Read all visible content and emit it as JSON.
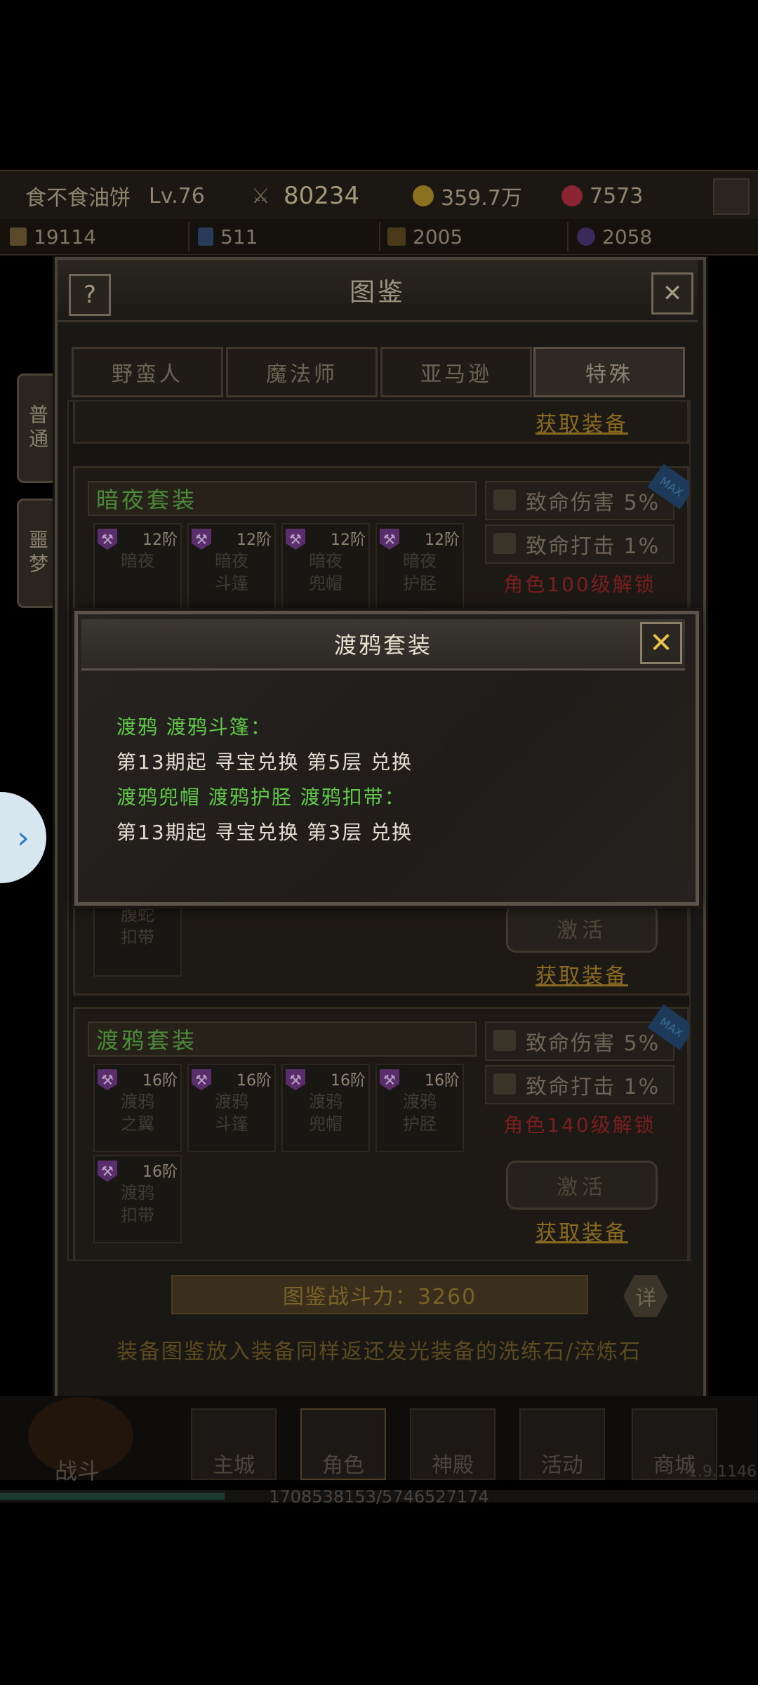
{
  "topbar": {
    "player_name": "食不食油饼",
    "level": "Lv.76",
    "combat_power": "80234",
    "gold": "359.7万",
    "gems": "7573"
  },
  "resources": [
    "19114",
    "511",
    "2005",
    "2058"
  ],
  "panel": {
    "title": "图鉴",
    "help_label": "?",
    "close_label": "✕",
    "side_tabs": [
      "普通",
      "噩梦"
    ],
    "class_tabs": [
      "野蛮人",
      "魔法师",
      "亚马逊",
      "特殊"
    ],
    "active_tab_index": 3,
    "get_equipment_label": "获取装备",
    "activate_label": "激活",
    "sets": [
      {
        "name": "暗夜套装",
        "items": [
          {
            "level": "12阶",
            "name": "暗夜"
          },
          {
            "level": "12阶",
            "name": "暗夜斗篷"
          },
          {
            "level": "12阶",
            "name": "暗夜兜帽"
          },
          {
            "level": "12阶",
            "name": "暗夜护胫"
          }
        ],
        "stats": [
          "致命伤害 5%",
          "致命打击 1%"
        ],
        "unlock": "角色100级解锁"
      },
      {
        "partial_item_name": "腹蛇扣带",
        "activate": "激活",
        "get": "获取装备"
      },
      {
        "name": "渡鸦套装",
        "items": [
          {
            "level": "16阶",
            "name": "渡鸦之翼"
          },
          {
            "level": "16阶",
            "name": "渡鸦斗篷"
          },
          {
            "level": "16阶",
            "name": "渡鸦兜帽"
          },
          {
            "level": "16阶",
            "name": "渡鸦护胫"
          },
          {
            "level": "16阶",
            "name": "渡鸦扣带"
          }
        ],
        "stats": [
          "致命伤害 5%",
          "致命打击 1%"
        ],
        "unlock": "角色140级解锁"
      }
    ],
    "power_label": "图鉴战斗力：3260",
    "detail_label": "详",
    "notice": "装备图鉴放入装备同样返还发光装备的洗练石/淬炼石"
  },
  "popup": {
    "title": "渡鸦套装",
    "close_label": "✕",
    "lines": [
      {
        "text": "渡鸦 渡鸦斗篷：",
        "color": "green"
      },
      {
        "text": "第13期起 寻宝兑换 第5层 兑换",
        "color": "white"
      },
      {
        "text": "渡鸦兜帽 渡鸦护胫 渡鸦扣带：",
        "color": "green"
      },
      {
        "text": "第13期起 寻宝兑换 第3层 兑换",
        "color": "white"
      }
    ]
  },
  "bottom_nav": [
    "战斗",
    "主城",
    "角色",
    "神殿",
    "活动",
    "商城"
  ],
  "version": "1.9.1146",
  "exp_text": "1708538153/5746527174",
  "side_handle_icon": "chevron-right-icon"
}
